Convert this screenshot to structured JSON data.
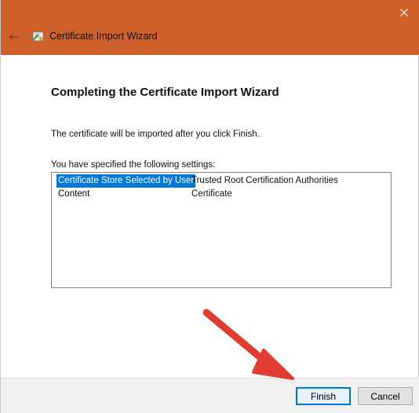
{
  "titlebar": {
    "title": "Certificate Import Wizard",
    "accent_color": "#d0602b",
    "back_icon": "back-arrow-icon",
    "app_icon": "certificate-wizard-icon",
    "close_icon": "close-icon"
  },
  "main": {
    "heading": "Completing the Certificate Import Wizard",
    "info": "The certificate will be imported after you click Finish.",
    "settings_label": "You have specified the following settings:",
    "settings": [
      {
        "key": "Certificate Store Selected by User",
        "value": "Trusted Root Certification Authorities",
        "selected": true
      },
      {
        "key": "Content",
        "value": "Certificate",
        "selected": false
      }
    ],
    "selection_color": "#0078d7"
  },
  "footer": {
    "finish_label": "Finish",
    "cancel_label": "Cancel"
  },
  "annotation": {
    "type": "arrow",
    "color": "#e03c31"
  }
}
